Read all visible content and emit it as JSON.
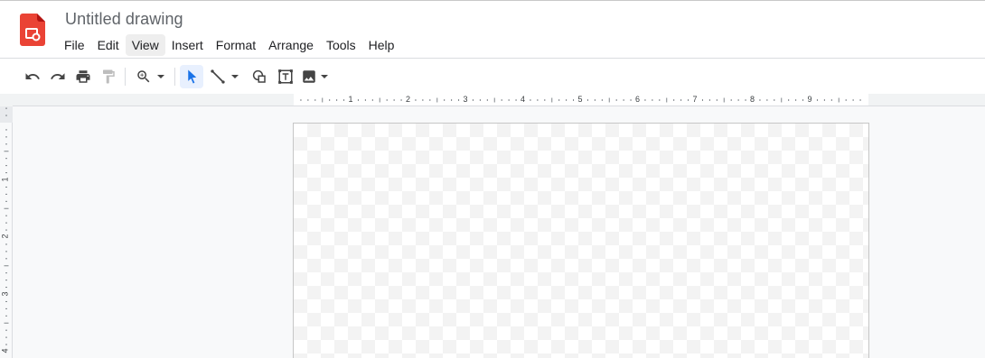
{
  "app": {
    "title": "Untitled drawing",
    "logo_icon": "google-drawings-logo",
    "brand_color": "#ea4335"
  },
  "menu": {
    "items": [
      {
        "label": "File"
      },
      {
        "label": "Edit"
      },
      {
        "label": "View",
        "active": true
      },
      {
        "label": "Insert"
      },
      {
        "label": "Format"
      },
      {
        "label": "Arrange"
      },
      {
        "label": "Tools"
      },
      {
        "label": "Help"
      }
    ]
  },
  "toolbar": {
    "icons": [
      "undo-icon",
      "redo-icon",
      "print-icon",
      "paint-format-icon",
      "zoom-icon",
      "select-icon",
      "line-icon",
      "shape-icon",
      "text-box-icon",
      "image-icon"
    ],
    "selected_tool": "select",
    "selected_color": "#1a73e8"
  },
  "rulers": {
    "horizontal": [
      "1",
      "2",
      "3",
      "4",
      "5",
      "6",
      "7",
      "8",
      "9"
    ],
    "vertical": [
      "1",
      "2",
      "3",
      "4"
    ]
  }
}
